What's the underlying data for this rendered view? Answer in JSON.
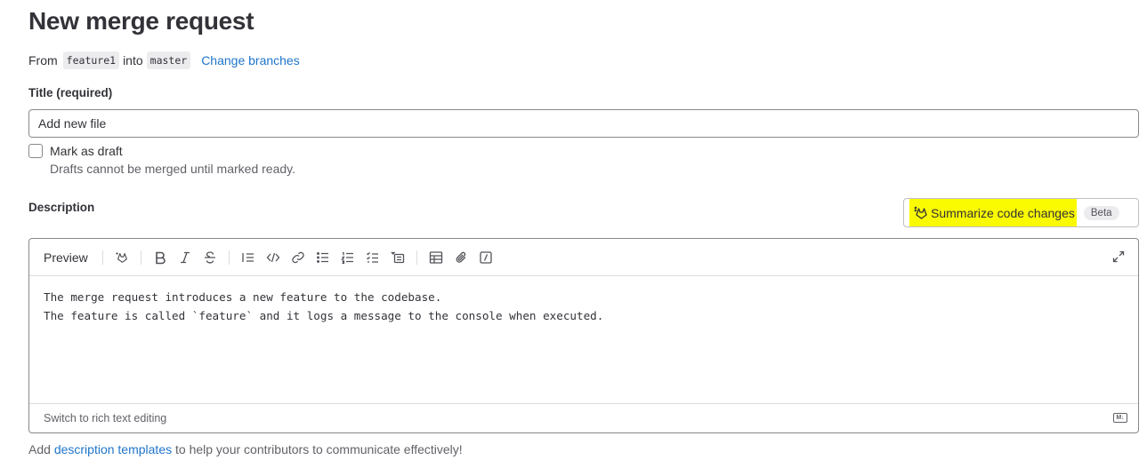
{
  "page": {
    "title": "New merge request"
  },
  "branches": {
    "from_label": "From",
    "source": "feature1",
    "into_label": "into",
    "target": "master",
    "change_link": "Change branches"
  },
  "title_field": {
    "label": "Title (required)",
    "value": "Add new file"
  },
  "draft": {
    "label": "Mark as draft",
    "help": "Drafts cannot be merged until marked ready.",
    "checked": false
  },
  "description": {
    "label": "Description",
    "summarize_button": "Summarize code changes",
    "beta_badge": "Beta",
    "toolbar": {
      "preview_label": "Preview",
      "icons": [
        "ai-tanuki-icon",
        "bold-icon",
        "italic-icon",
        "strikethrough-icon",
        "quote-icon",
        "code-icon",
        "link-icon",
        "bullet-list-icon",
        "numbered-list-icon",
        "task-list-icon",
        "collapsible-icon",
        "table-icon",
        "attach-icon",
        "slash-command-icon",
        "fullscreen-icon"
      ]
    },
    "text_line1": "The merge request introduces a new feature to the codebase.",
    "text_line2": "The feature is called `feature` and it logs a message to the console when executed.",
    "footer_link": "Switch to rich text editing",
    "markdown_badge": "M↓"
  },
  "templates_note": {
    "prefix": "Add ",
    "link": "description templates",
    "suffix": " to help your contributors to communicate effectively!"
  },
  "colors": {
    "link": "#1f75cb",
    "highlight": "#fafa00",
    "text": "#333238",
    "muted": "#626168"
  }
}
